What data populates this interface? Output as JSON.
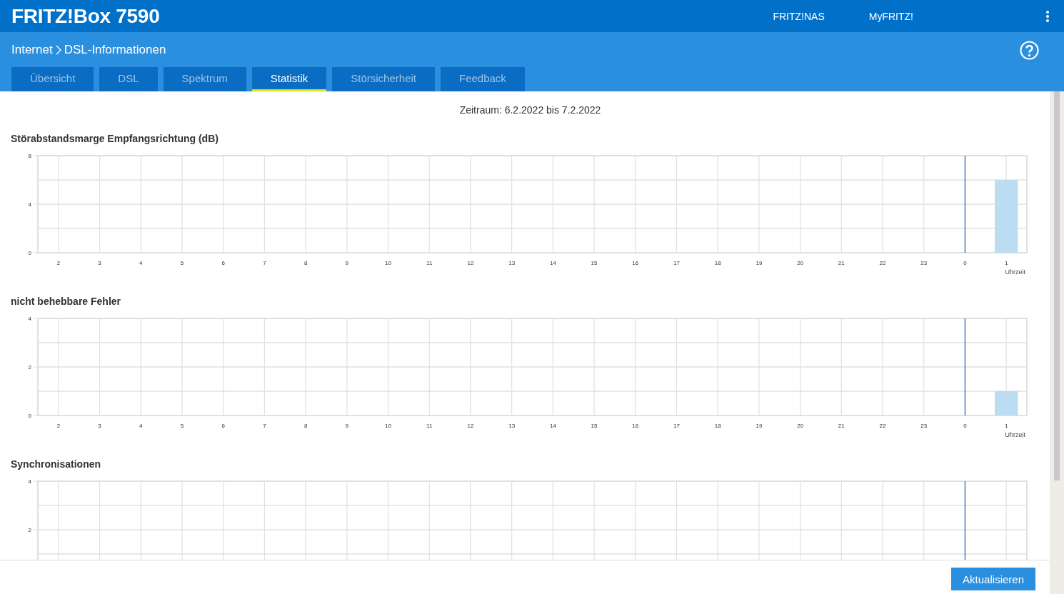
{
  "header": {
    "title": "FRITZ!Box 7590",
    "links": [
      "FRITZ!NAS",
      "MyFRITZ!"
    ]
  },
  "breadcrumb": [
    "Internet",
    "DSL-Informationen"
  ],
  "tabs": [
    {
      "label": "Übersicht",
      "selected": false
    },
    {
      "label": "DSL",
      "selected": false
    },
    {
      "label": "Spektrum",
      "selected": false
    },
    {
      "label": "Statistik",
      "selected": true
    },
    {
      "label": "Störsicherheit",
      "selected": false
    },
    {
      "label": "Feedback",
      "selected": false
    }
  ],
  "period": "Zeitraum: 6.2.2022 bis 7.2.2022",
  "charts": [
    {
      "chart_data": {
        "type": "bar",
        "title": "Störabstandsmarge Empfangsrichtung (dB)",
        "xlabel": "Uhrzeit",
        "grid": true,
        "categories": [
          "2",
          "3",
          "4",
          "5",
          "6",
          "7",
          "8",
          "9",
          "10",
          "11",
          "12",
          "13",
          "14",
          "15",
          "16",
          "17",
          "18",
          "19",
          "20",
          "21",
          "22",
          "23",
          "0",
          "1"
        ],
        "series": [
          {
            "color": "#bcdcf2",
            "values": [
              null,
              null,
              null,
              null,
              null,
              null,
              null,
              null,
              null,
              null,
              null,
              null,
              null,
              null,
              null,
              null,
              null,
              null,
              null,
              null,
              null,
              null,
              null,
              6
            ]
          }
        ],
        "ylim": [
          0,
          8
        ],
        "yticks": [
          0,
          4,
          8
        ],
        "ref_lines": [
          {
            "axis": "x",
            "value": "0",
            "color": "#1f5fa8"
          }
        ]
      }
    },
    {
      "chart_data": {
        "type": "bar",
        "title": "nicht behebbare Fehler",
        "xlabel": "Uhrzeit",
        "grid": true,
        "categories": [
          "2",
          "3",
          "4",
          "5",
          "6",
          "7",
          "8",
          "9",
          "10",
          "11",
          "12",
          "13",
          "14",
          "15",
          "16",
          "17",
          "18",
          "19",
          "20",
          "21",
          "22",
          "23",
          "0",
          "1"
        ],
        "series": [
          {
            "color": "#bcdcf2",
            "values": [
              null,
              null,
              null,
              null,
              null,
              null,
              null,
              null,
              null,
              null,
              null,
              null,
              null,
              null,
              null,
              null,
              null,
              null,
              null,
              null,
              null,
              null,
              null,
              1
            ]
          }
        ],
        "ylim": [
          0,
          4
        ],
        "yticks": [
          0,
          2,
          4
        ],
        "ref_lines": [
          {
            "axis": "x",
            "value": "0",
            "color": "#1f5fa8"
          }
        ]
      }
    },
    {
      "chart_data": {
        "type": "other",
        "title": "Synchronisationen"
      },
      "y_labels": [
        "4",
        "2"
      ]
    }
  ],
  "footer": {
    "button": "Aktualisieren"
  }
}
